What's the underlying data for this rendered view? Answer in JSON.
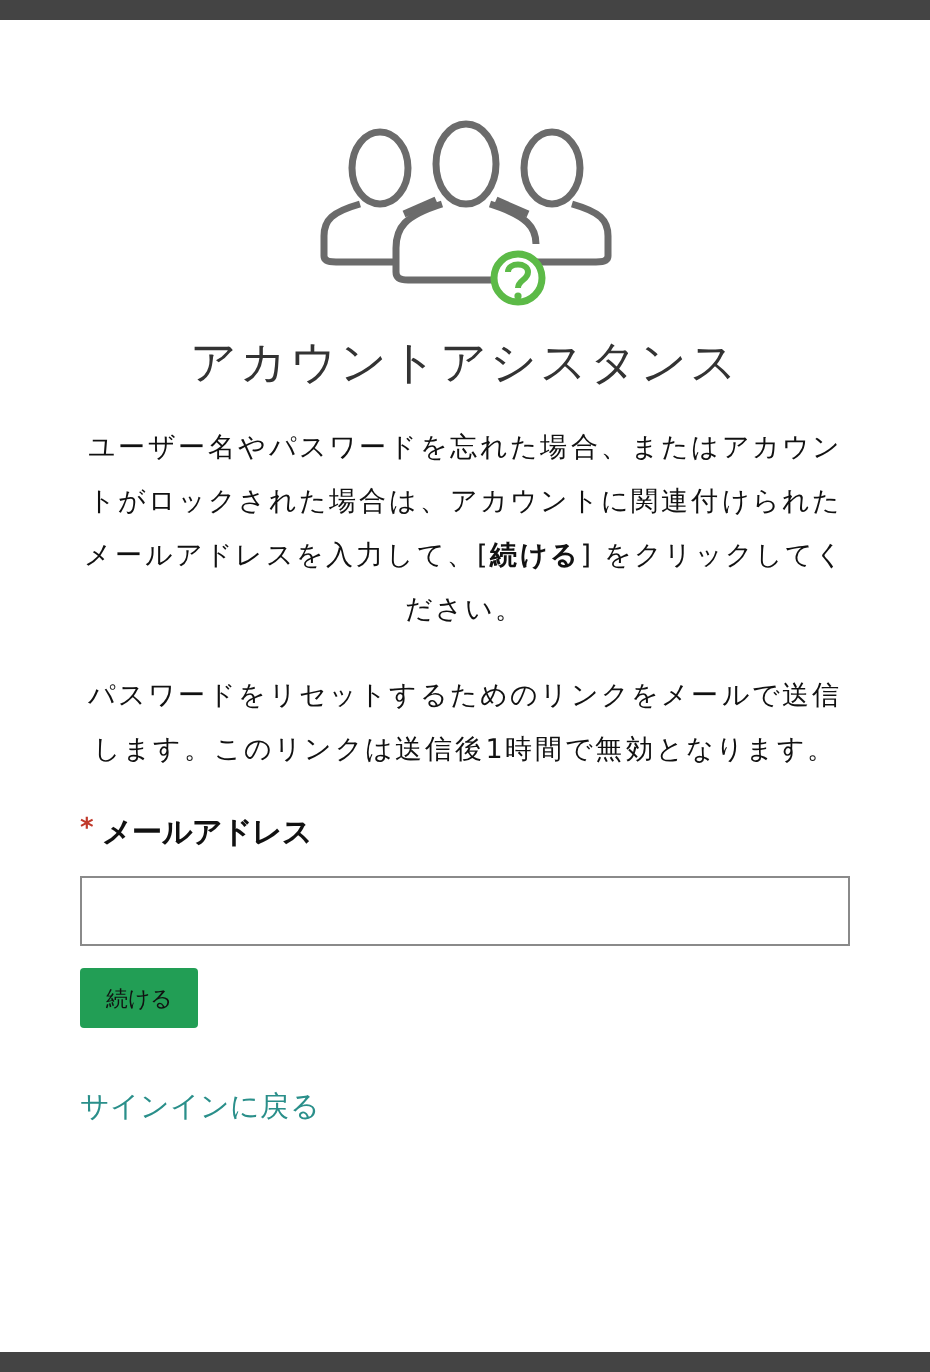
{
  "title": "アカウントアシスタンス",
  "paragraphs": [
    "ユーザー名やパスワードを忘れた場合、またはアカウントがロックされた場合は、アカウントに関連付けられたメールアドレスを入力して、[**続ける**] をクリックしてください。",
    "パスワードをリセットするためのリンクをメールで送信します。このリンクは送信後1時間で無効となります。"
  ],
  "email_field": {
    "required_mark": "*",
    "label": "メールアドレス"
  },
  "continue_button": "続ける",
  "back_link": "サインインに戻る"
}
